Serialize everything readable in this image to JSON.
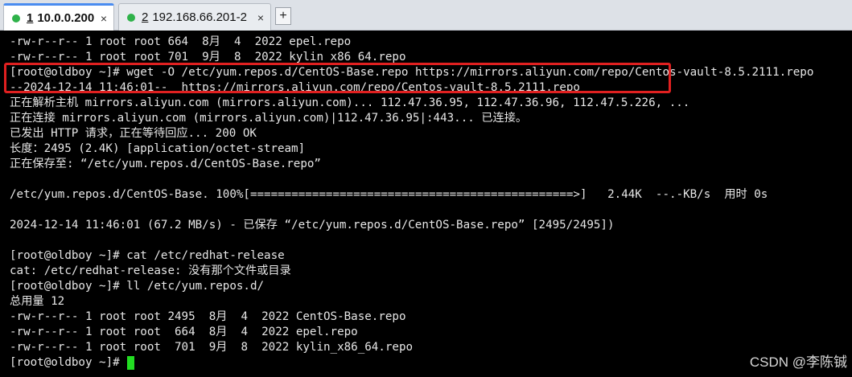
{
  "tabs": [
    {
      "number": "1",
      "label": "10.0.0.200",
      "close": "×",
      "active": true
    },
    {
      "number": "2",
      "label": "192.168.66.201-2",
      "close": "×",
      "active": false
    }
  ],
  "new_tab_label": "+",
  "colors": {
    "background": "#000000",
    "text": "#e6e6e6",
    "cursor": "#22dd22",
    "highlight_border": "#e02020",
    "tab_status": "#2fb24a"
  },
  "terminal_lines": [
    "-rw-r--r-- 1 root root 664  8月  4  2022 epel.repo",
    "-rw-r--r-- 1 root root 701  9月  8  2022 kylin_x86_64.repo",
    "[root@oldboy ~]# wget -O /etc/yum.repos.d/CentOS-Base.repo https://mirrors.aliyun.com/repo/Centos-vault-8.5.2111.repo",
    "--2024-12-14 11:46:01--  https://mirrors.aliyun.com/repo/Centos-vault-8.5.2111.repo",
    "正在解析主机 mirrors.aliyun.com (mirrors.aliyun.com)... 112.47.36.95, 112.47.36.96, 112.47.5.226, ...",
    "正在连接 mirrors.aliyun.com (mirrors.aliyun.com)|112.47.36.95|:443... 已连接。",
    "已发出 HTTP 请求，正在等待回应... 200 OK",
    "长度：2495 (2.4K) [application/octet-stream]",
    "正在保存至: “/etc/yum.repos.d/CentOS-Base.repo”",
    "",
    "/etc/yum.repos.d/CentOS-Base. 100%[===============================================>]   2.44K  --.-KB/s  用时 0s",
    "",
    "2024-12-14 11:46:01 (67.2 MB/s) - 已保存 “/etc/yum.repos.d/CentOS-Base.repo” [2495/2495])",
    "",
    "[root@oldboy ~]# cat /etc/redhat-release",
    "cat: /etc/redhat-release: 没有那个文件或目录",
    "[root@oldboy ~]# ll /etc/yum.repos.d/",
    "总用量 12",
    "-rw-r--r-- 1 root root 2495  8月  4  2022 CentOS-Base.repo",
    "-rw-r--r-- 1 root root  664  8月  4  2022 epel.repo",
    "-rw-r--r-- 1 root root  701  9月  8  2022 kylin_x86_64.repo"
  ],
  "prompt": "[root@oldboy ~]# ",
  "watermark": "CSDN @李陈铖"
}
